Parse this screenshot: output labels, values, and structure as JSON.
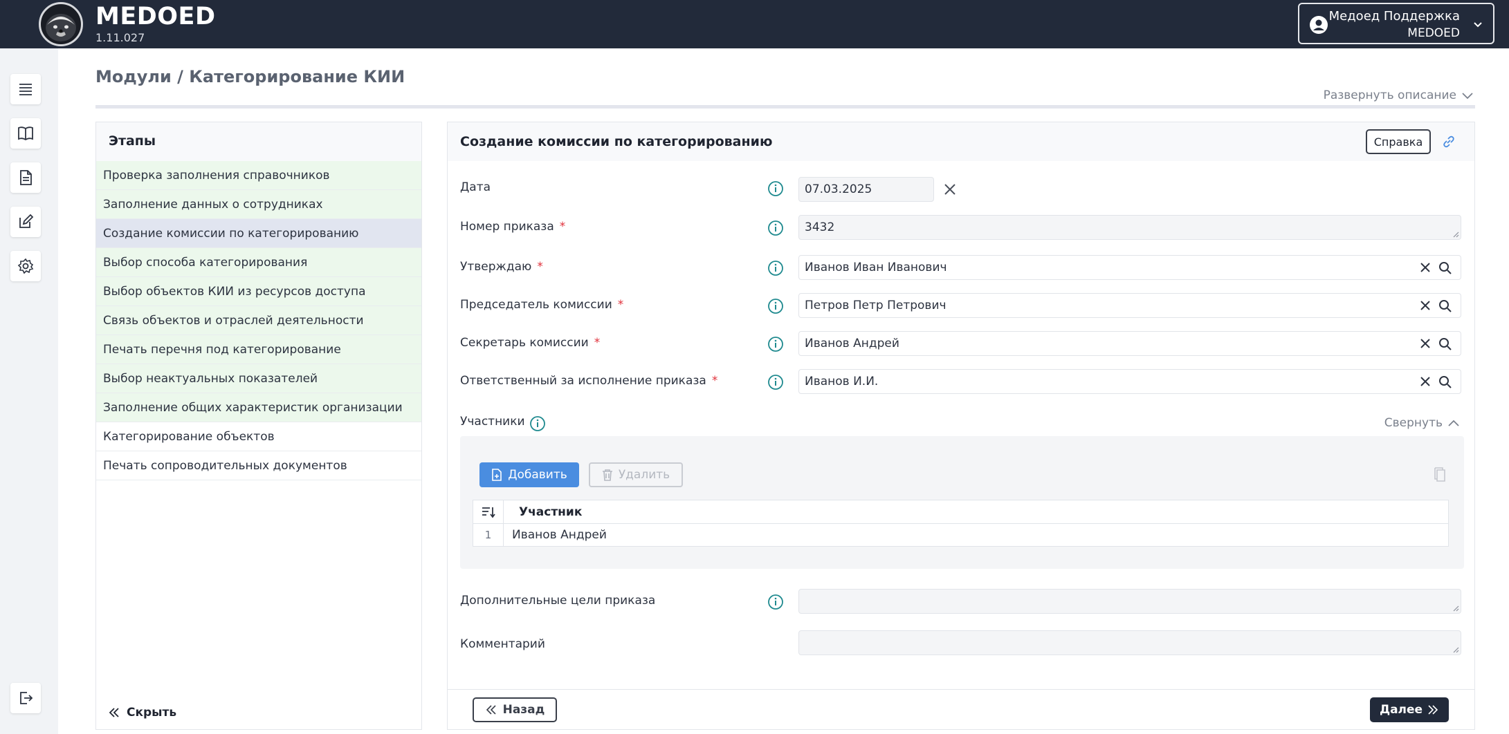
{
  "header": {
    "app_name": "MEDOED",
    "version": "1.11.027",
    "user_name": "Медоед Поддержка",
    "user_org": "MEDOED"
  },
  "rail": {
    "items": [
      "list-icon",
      "book-icon",
      "document-icon",
      "edit-icon",
      "settings-icon"
    ],
    "logout": "logout-icon"
  },
  "page": {
    "breadcrumb": "Модули / Категорирование КИИ",
    "expand_description": "Развернуть описание"
  },
  "stages": {
    "title": "Этапы",
    "items": [
      {
        "label": "Проверка заполнения справочников",
        "state": "done"
      },
      {
        "label": "Заполнение данных о сотрудниках",
        "state": "done"
      },
      {
        "label": "Создание комиссии по категорированию",
        "state": "active"
      },
      {
        "label": "Выбор способа категорирования",
        "state": "done"
      },
      {
        "label": "Выбор объектов КИИ из ресурсов доступа",
        "state": "done"
      },
      {
        "label": "Связь объектов и отраслей деятельности",
        "state": "done"
      },
      {
        "label": "Печать перечня под категорирование",
        "state": "done"
      },
      {
        "label": "Выбор неактуальных показателей",
        "state": "done"
      },
      {
        "label": "Заполнение общих характеристик организации",
        "state": "done"
      },
      {
        "label": "Категорирование объектов",
        "state": "todo"
      },
      {
        "label": "Печать сопроводительных документов",
        "state": "todo"
      }
    ],
    "hide_label": "Скрыть"
  },
  "form": {
    "title": "Создание комиссии по категорированию",
    "help_label": "Справка",
    "date": {
      "label": "Дата",
      "value": "07.03.2025"
    },
    "order_number": {
      "label": "Номер приказа",
      "value": "3432"
    },
    "approver": {
      "label": "Утверждаю",
      "value": "Иванов Иван Иванович"
    },
    "chairman": {
      "label": "Председатель комиссии",
      "value": "Петров Петр Петрович"
    },
    "secretary": {
      "label": "Секретарь комиссии",
      "value": "Иванов Андрей"
    },
    "responsible": {
      "label": "Ответственный за исполнение приказа",
      "value": "Иванов И.И."
    },
    "participants": {
      "label": "Участники",
      "collapse_label": "Свернуть",
      "add_label": "Добавить",
      "delete_label": "Удалить",
      "column": "Участник",
      "rows": [
        {
          "num": "1",
          "name": "Иванов Андрей"
        }
      ]
    },
    "extra_goals": {
      "label": "Дополнительные цели приказа",
      "value": ""
    },
    "comment": {
      "label": "Комментарий",
      "value": ""
    },
    "back_label": "Назад",
    "next_label": "Далее"
  },
  "colors": {
    "header_bg": "#222a3a",
    "accent": "#4a8de0",
    "info_icon": "#1f8a8f",
    "stage_done_bg": "#ecf8ec",
    "stage_active_bg": "#e1e5f0",
    "required": "#e0313b"
  }
}
